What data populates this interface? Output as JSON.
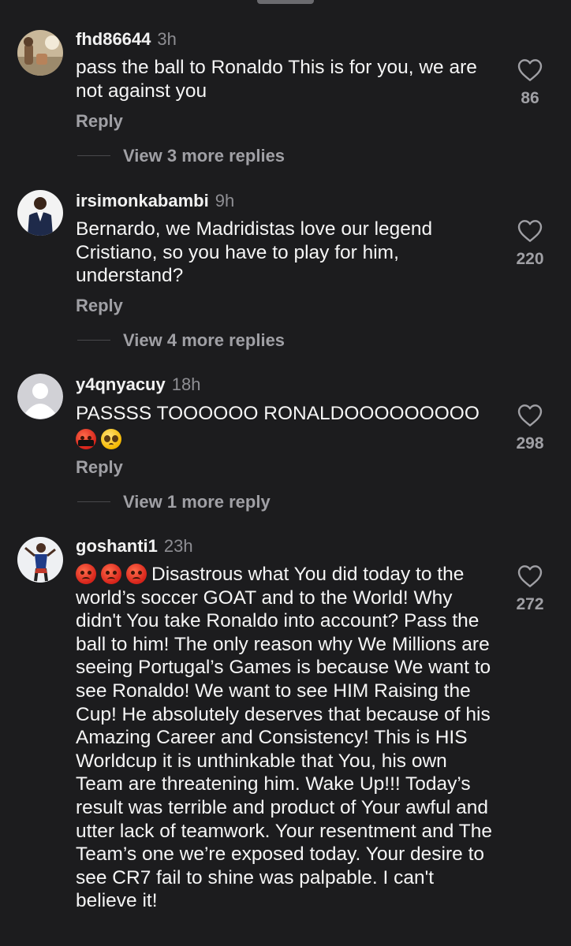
{
  "comments": [
    {
      "username": "fhd86644",
      "time": "3h",
      "text": "pass the ball to Ronaldo This is for you, we are not against you",
      "reply_label": "Reply",
      "view_more": "View 3 more replies",
      "likes": "86"
    },
    {
      "username": "irsimonkabambi",
      "time": "9h",
      "text": "Bernardo, we Madridistas love our legend Cristiano, so you have to play for him, understand?",
      "reply_label": "Reply",
      "view_more": "View 4 more replies",
      "likes": "220"
    },
    {
      "username": "y4qnyacuy",
      "time": "18h",
      "text": "PASSSS TOOOOOO RONALDOOOOOOOOO",
      "emojis": [
        "cursing-face-emoji",
        "pleading-face-emoji"
      ],
      "reply_label": "Reply",
      "view_more": "View 1 more reply",
      "likes": "298"
    },
    {
      "username": "goshanti1",
      "time": "23h",
      "emojis": [
        "angry-face-emoji",
        "angry-face-emoji",
        "angry-face-emoji"
      ],
      "text": "Disastrous what You did today to the world’s soccer GOAT and to the World! Why didn't You take Ronaldo into account? Pass the ball to him! The only reason why We Millions are seeing Portugal’s Games is because We want to see Ronaldo! We want to see HIM Raising the Cup! He absolutely deserves that because of his Amazing Career and Consistency! This is HIS Worldcup it is unthinkable that You, his own Team are threatening him. Wake Up!!! Today’s result was terrible and product of Your awful and utter lack of teamwork. Your resentment and The Team’s one we’re exposed today. Your desire to see CR7 fail to shine was palpable. I can't believe it!",
      "likes": "272"
    }
  ],
  "icons": {
    "like": "heart-outline-icon",
    "avatar_default": "default-avatar-icon"
  },
  "colors": {
    "background": "#1c1c1e",
    "primary_text": "#f5f5f5",
    "secondary_text": "#a0a0a5",
    "timestamp": "#8e8e93"
  }
}
